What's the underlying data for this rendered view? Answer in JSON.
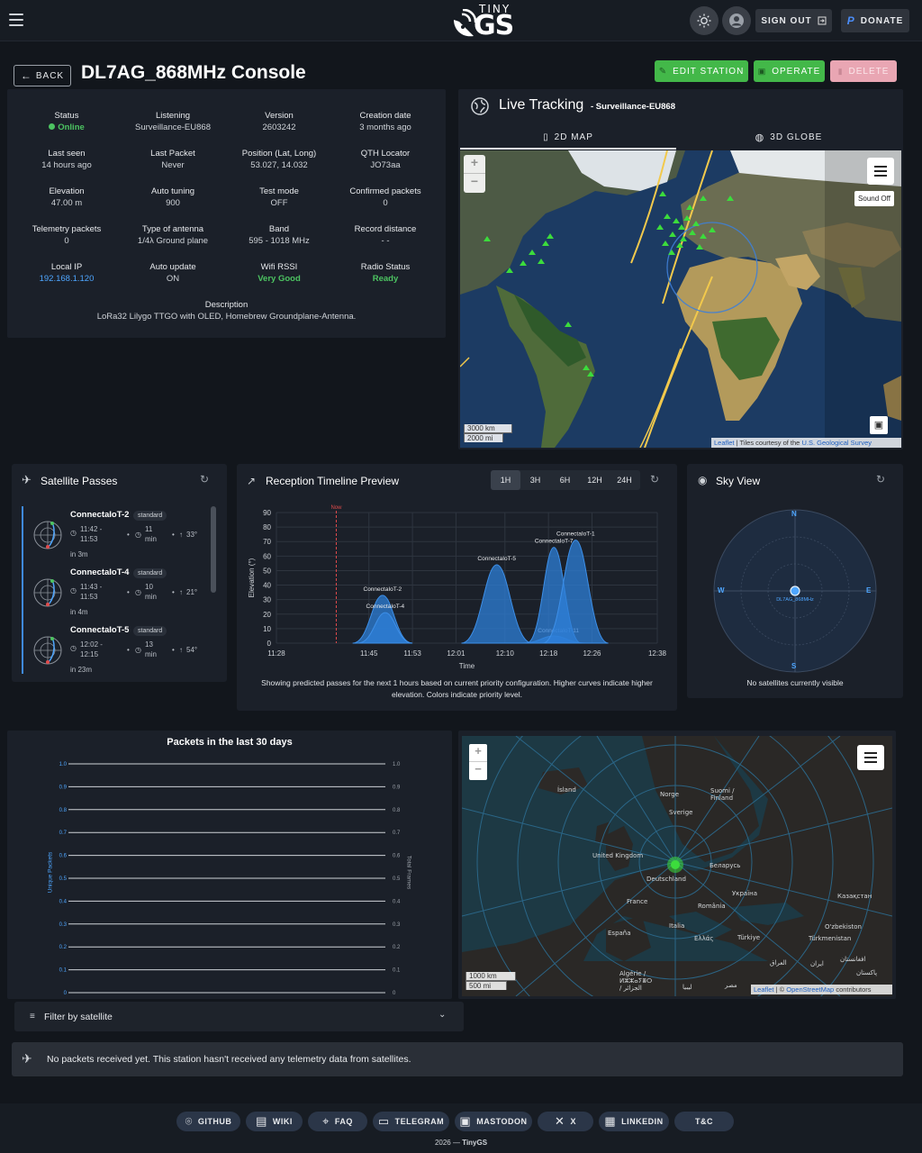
{
  "header": {
    "logo_top": "TINY",
    "logo_main": "GS",
    "sign_out_label": "SIGN OUT",
    "donate_label": "DONATE"
  },
  "station": {
    "back_label": "BACK",
    "title": "DL7AG_868MHz Console",
    "edit_label": "EDIT STATION",
    "operate_label": "OPERATE",
    "delete_label": "DELETE"
  },
  "info": [
    {
      "label": "Status",
      "value": "Online"
    },
    {
      "label": "Listening",
      "value": "Surveillance-EU868"
    },
    {
      "label": "Version",
      "value": "2603242"
    },
    {
      "label": "Creation date",
      "value": "3 months ago"
    },
    {
      "label": "Last seen",
      "value": "14 hours ago"
    },
    {
      "label": "Last Packet",
      "value": "Never"
    },
    {
      "label": "Position (Lat, Long)",
      "value": "53.027, 14.032"
    },
    {
      "label": "QTH Locator",
      "value": "JO73aa"
    },
    {
      "label": "Elevation",
      "value": "47.00 m"
    },
    {
      "label": "Auto tuning",
      "value": "900"
    },
    {
      "label": "Test mode",
      "value": "OFF"
    },
    {
      "label": "Confirmed packets",
      "value": "0"
    },
    {
      "label": "Telemetry packets",
      "value": "0"
    },
    {
      "label": "Type of antenna",
      "value": "1/4λ Ground plane"
    },
    {
      "label": "Band",
      "value": "595 - 1018 MHz"
    },
    {
      "label": "Record distance",
      "value": "- -"
    },
    {
      "label": "Local IP",
      "value": "192.168.1.120"
    },
    {
      "label": "Auto update",
      "value": "ON"
    },
    {
      "label": "Wifi RSSI",
      "value": "Very Good"
    },
    {
      "label": "Radio Status",
      "value": "Ready"
    }
  ],
  "description": {
    "label": "Description",
    "value": "LoRa32 Lilygo TTGO with OLED, Homebrew Groundplane-Antenna."
  },
  "live_tracking": {
    "title": "Live Tracking",
    "subtitle": "- Surveillance-EU868",
    "tab_2d": "2D MAP",
    "tab_3d": "3D GLOBE",
    "sound_label": "Sound Off",
    "scale_km": "3000 km",
    "scale_mi": "2000 mi",
    "attribution_leaflet": "Leaflet",
    "attribution_text": "| Tiles courtesy of the",
    "attribution_link": "U.S. Geological Survey"
  },
  "passes": {
    "title": "Satellite Passes",
    "items": [
      {
        "name": "ConnectaIoT-2",
        "badge": "standard",
        "time1": "11:42 -",
        "time2": "11:53",
        "dur1": "11",
        "dur2": "min",
        "max": "33°",
        "eta": "in 3m"
      },
      {
        "name": "ConnectaIoT-4",
        "badge": "standard",
        "time1": "11:43 -",
        "time2": "11:53",
        "dur1": "10",
        "dur2": "min",
        "max": "21°",
        "eta": "in 4m"
      },
      {
        "name": "ConnectaIoT-5",
        "badge": "standard",
        "time1": "12:02 -",
        "time2": "12:15",
        "dur1": "13",
        "dur2": "min",
        "max": "54°",
        "eta": "in 23m"
      }
    ]
  },
  "timeline": {
    "title": "Reception Timeline Preview",
    "ranges": [
      "1H",
      "3H",
      "6H",
      "12H",
      "24H"
    ],
    "caption": "Showing predicted passes for the next 1 hours based on current priority configuration. Higher curves indicate higher elevation. Colors indicate priority level."
  },
  "sky": {
    "title": "Sky View",
    "station": "DL7AG_868MHz",
    "n": "N",
    "s": "S",
    "e": "E",
    "w": "W",
    "empty": "No satellites currently visible"
  },
  "packets": {
    "title": "Packets in the last 30 days",
    "left_axis": "Unique Packets",
    "right_axis": "Total Frames"
  },
  "map2": {
    "labels": [
      "Ísland",
      "Norge",
      "Suomi / Finland",
      "Sverige",
      "United Kingdom",
      "Беларусь",
      "Deutschland",
      "Україна",
      "France",
      "România",
      "Казақстан",
      "España",
      "Italia",
      "Ελλάς",
      "Türkiye",
      "O'zbekiston",
      "Türkmenistan",
      "Algérie / ⵍⵣⵣⴰⵢⴻⵔ / الجزائر",
      "العراق",
      "ایران",
      "افغانستان",
      "ليبيا",
      "مصر",
      "پاکستان"
    ],
    "scale_km": "1000 km",
    "scale_mi": "500 mi",
    "attribution_leaflet": "Leaflet",
    "attribution_osm": "OpenStreetMap",
    "attribution_rest": "contributors"
  },
  "filter": {
    "label": "Filter by satellite"
  },
  "no_packets": {
    "text": "No packets received yet. This station hasn't received any telemetry data from satellites."
  },
  "footer": {
    "links": [
      "GITHUB",
      "WIKI",
      "FAQ",
      "TELEGRAM",
      "MASTODON",
      "X",
      "LINKEDIN",
      "T&C"
    ],
    "copyright_year": "2026 —",
    "copyright_name": "TinyGS"
  },
  "chart_data": [
    {
      "type": "area",
      "title": "",
      "xlabel": "Time",
      "ylabel": "Elevation (°)",
      "ylim": [
        0,
        90
      ],
      "x_ticks": [
        "11:28",
        "11:45",
        "11:53",
        "12:01",
        "12:10",
        "12:18",
        "12:26",
        "12:38"
      ],
      "y_ticks": [
        0,
        10,
        20,
        30,
        40,
        50,
        60,
        70,
        80,
        90
      ],
      "now_label": "Now",
      "now_time": "11:39",
      "series": [
        {
          "name": "ConnectaIoT-2",
          "start": "11:42",
          "end": "11:53",
          "peak": 33
        },
        {
          "name": "ConnectaIoT-4",
          "start": "11:43",
          "end": "11:53",
          "peak": 21
        },
        {
          "name": "ConnectaIoT-5",
          "start": "12:02",
          "end": "12:15",
          "peak": 54
        },
        {
          "name": "ConnectaIoT-11",
          "start": "12:13",
          "end": "12:25",
          "peak": 5
        },
        {
          "name": "ConnectaIoT-7",
          "start": "12:14",
          "end": "12:24",
          "peak": 66
        },
        {
          "name": "ConnectaIoT-1",
          "start": "12:17",
          "end": "12:29",
          "peak": 71
        }
      ]
    },
    {
      "type": "line",
      "title": "Packets in the last 30 days",
      "ylabel": "Unique Packets",
      "y2label": "Total Frames",
      "ylim": [
        0,
        1
      ],
      "y_ticks": [
        "0",
        "0.1",
        "0.2",
        "0.3",
        "0.4",
        "0.5",
        "0.6",
        "0.7",
        "0.8",
        "0.9",
        "1.0"
      ],
      "series": []
    }
  ]
}
